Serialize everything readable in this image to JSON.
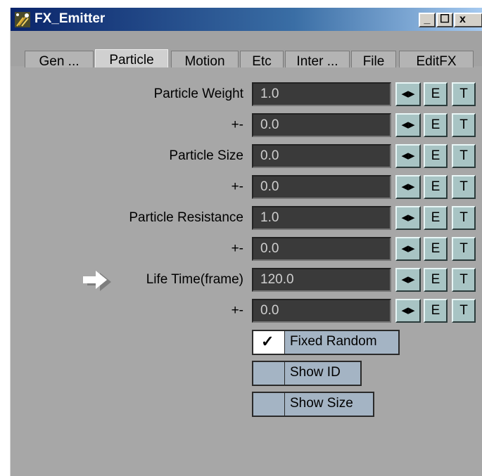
{
  "window": {
    "title": "FX_Emitter",
    "minimize_label": "_",
    "maximize_label": "☐",
    "close_label": "x"
  },
  "tabs": [
    {
      "label": "Gen ..."
    },
    {
      "label": "Particle"
    },
    {
      "label": "Motion"
    },
    {
      "label": "Etc"
    },
    {
      "label": "Inter ..."
    },
    {
      "label": "File"
    },
    {
      "label": "EditFX"
    }
  ],
  "active_tab": "Particle",
  "rows": [
    {
      "label": "Particle Weight",
      "value": "1.0"
    },
    {
      "label": "+-",
      "value": "0.0"
    },
    {
      "label": "Particle Size",
      "value": "0.0"
    },
    {
      "label": "+-",
      "value": "0.0"
    },
    {
      "label": "Particle Resistance",
      "value": "1.0"
    },
    {
      "label": "+-",
      "value": "0.0"
    },
    {
      "label": "Life Time(frame)",
      "value": "120.0"
    },
    {
      "label": "+-",
      "value": "0.0"
    }
  ],
  "row_buttons": {
    "slider": "◂▸",
    "envelope": "E",
    "texture": "T"
  },
  "checkboxes": [
    {
      "label": "Fixed Random",
      "checked": true,
      "check_glyph": "✓"
    },
    {
      "label": "Show ID",
      "checked": false
    },
    {
      "label": "Show Size",
      "checked": false
    }
  ],
  "icons": {
    "app": "sprinkler-icon",
    "pointer": "right-arrow-icon"
  },
  "colors": {
    "title_gradient_start": "#0a246a",
    "panel_bg": "#a7a7a7",
    "field_bg": "#3a3a3a",
    "button_bg": "#a8c4c4",
    "checkbox_bg": "#a4b4c4"
  }
}
